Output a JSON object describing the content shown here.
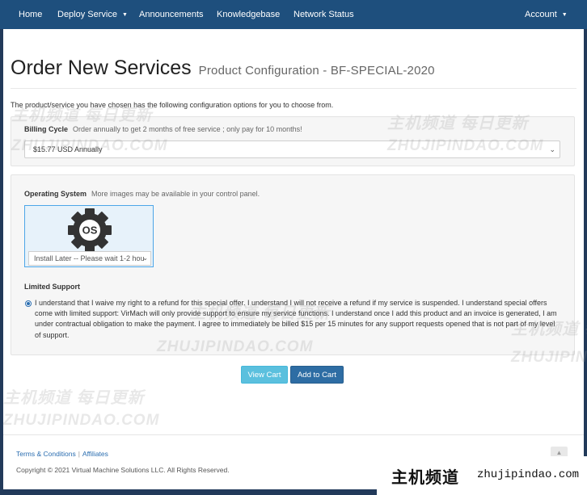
{
  "navbar": {
    "items": [
      {
        "label": "Home"
      },
      {
        "label": "Deploy Service",
        "dropdown": true
      },
      {
        "label": "Announcements"
      },
      {
        "label": "Knowledgebase"
      },
      {
        "label": "Network Status"
      }
    ],
    "account": {
      "label": "Account",
      "dropdown": true
    },
    "caret_glyph": "▼"
  },
  "page": {
    "title": "Order New Services",
    "subtitle": "Product Configuration - BF-SPECIAL-2020",
    "intro": "The product/service you have chosen has the following configuration options for you to choose from."
  },
  "billing": {
    "label": "Billing Cycle",
    "description": "Order annually to get 2 months of free service ; only pay for 10 months!",
    "selected": "$15.77 USD Annually"
  },
  "os": {
    "label": "Operating System",
    "description": "More images may be available in your control panel.",
    "icon": "os-gear-icon",
    "icon_text": "OS",
    "selected": "Install Later -- Please wait 1-2 hou"
  },
  "support": {
    "label": "Limited Support",
    "checked": true,
    "text": "I understand that I waive my right to a refund for this special offer. I understand I will not receive a refund if my service is suspended. I understand special offers come with limited support: VirMach will only provide support to ensure my service functions. I understand once I add this product and an invoice is generated, I am under contractual obligation to make the payment. I agree to immediately be billed $15 per 15 minutes for any support requests opened that is not part of my level of support."
  },
  "actions": {
    "view_cart": "View Cart",
    "add_to_cart": "Add to Cart"
  },
  "footer": {
    "links": [
      "Terms & Conditions",
      "Affiliates"
    ],
    "separator": "|",
    "copyright": "Copyright © 2021 Virtual Machine Solutions LLC. All Rights Reserved.",
    "scroll_top_glyph": "▲"
  },
  "watermark": {
    "cn": "主机频道 每日更新",
    "en": "ZHUJIPINDAO.COM"
  },
  "badge": {
    "cn": "主机频道",
    "en": "zhujipindao.com"
  },
  "colors": {
    "navbar": "#1e4f7d",
    "primary_button": "#2e6da4",
    "info_button": "#5bc0de",
    "link": "#2a6db0"
  }
}
